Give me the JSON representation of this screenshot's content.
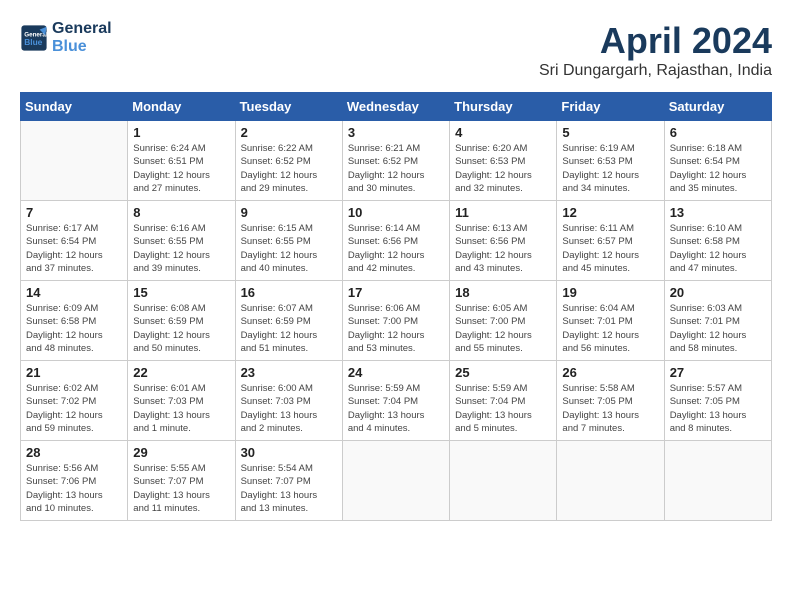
{
  "app": {
    "logo_line1": "General",
    "logo_line2": "Blue",
    "title": "April 2024",
    "subtitle": "Sri Dungargarh, Rajasthan, India"
  },
  "calendar": {
    "headers": [
      "Sunday",
      "Monday",
      "Tuesday",
      "Wednesday",
      "Thursday",
      "Friday",
      "Saturday"
    ],
    "weeks": [
      [
        {
          "day": "",
          "detail": ""
        },
        {
          "day": "1",
          "detail": "Sunrise: 6:24 AM\nSunset: 6:51 PM\nDaylight: 12 hours\nand 27 minutes."
        },
        {
          "day": "2",
          "detail": "Sunrise: 6:22 AM\nSunset: 6:52 PM\nDaylight: 12 hours\nand 29 minutes."
        },
        {
          "day": "3",
          "detail": "Sunrise: 6:21 AM\nSunset: 6:52 PM\nDaylight: 12 hours\nand 30 minutes."
        },
        {
          "day": "4",
          "detail": "Sunrise: 6:20 AM\nSunset: 6:53 PM\nDaylight: 12 hours\nand 32 minutes."
        },
        {
          "day": "5",
          "detail": "Sunrise: 6:19 AM\nSunset: 6:53 PM\nDaylight: 12 hours\nand 34 minutes."
        },
        {
          "day": "6",
          "detail": "Sunrise: 6:18 AM\nSunset: 6:54 PM\nDaylight: 12 hours\nand 35 minutes."
        }
      ],
      [
        {
          "day": "7",
          "detail": "Sunrise: 6:17 AM\nSunset: 6:54 PM\nDaylight: 12 hours\nand 37 minutes."
        },
        {
          "day": "8",
          "detail": "Sunrise: 6:16 AM\nSunset: 6:55 PM\nDaylight: 12 hours\nand 39 minutes."
        },
        {
          "day": "9",
          "detail": "Sunrise: 6:15 AM\nSunset: 6:55 PM\nDaylight: 12 hours\nand 40 minutes."
        },
        {
          "day": "10",
          "detail": "Sunrise: 6:14 AM\nSunset: 6:56 PM\nDaylight: 12 hours\nand 42 minutes."
        },
        {
          "day": "11",
          "detail": "Sunrise: 6:13 AM\nSunset: 6:56 PM\nDaylight: 12 hours\nand 43 minutes."
        },
        {
          "day": "12",
          "detail": "Sunrise: 6:11 AM\nSunset: 6:57 PM\nDaylight: 12 hours\nand 45 minutes."
        },
        {
          "day": "13",
          "detail": "Sunrise: 6:10 AM\nSunset: 6:58 PM\nDaylight: 12 hours\nand 47 minutes."
        }
      ],
      [
        {
          "day": "14",
          "detail": "Sunrise: 6:09 AM\nSunset: 6:58 PM\nDaylight: 12 hours\nand 48 minutes."
        },
        {
          "day": "15",
          "detail": "Sunrise: 6:08 AM\nSunset: 6:59 PM\nDaylight: 12 hours\nand 50 minutes."
        },
        {
          "day": "16",
          "detail": "Sunrise: 6:07 AM\nSunset: 6:59 PM\nDaylight: 12 hours\nand 51 minutes."
        },
        {
          "day": "17",
          "detail": "Sunrise: 6:06 AM\nSunset: 7:00 PM\nDaylight: 12 hours\nand 53 minutes."
        },
        {
          "day": "18",
          "detail": "Sunrise: 6:05 AM\nSunset: 7:00 PM\nDaylight: 12 hours\nand 55 minutes."
        },
        {
          "day": "19",
          "detail": "Sunrise: 6:04 AM\nSunset: 7:01 PM\nDaylight: 12 hours\nand 56 minutes."
        },
        {
          "day": "20",
          "detail": "Sunrise: 6:03 AM\nSunset: 7:01 PM\nDaylight: 12 hours\nand 58 minutes."
        }
      ],
      [
        {
          "day": "21",
          "detail": "Sunrise: 6:02 AM\nSunset: 7:02 PM\nDaylight: 12 hours\nand 59 minutes."
        },
        {
          "day": "22",
          "detail": "Sunrise: 6:01 AM\nSunset: 7:03 PM\nDaylight: 13 hours\nand 1 minute."
        },
        {
          "day": "23",
          "detail": "Sunrise: 6:00 AM\nSunset: 7:03 PM\nDaylight: 13 hours\nand 2 minutes."
        },
        {
          "day": "24",
          "detail": "Sunrise: 5:59 AM\nSunset: 7:04 PM\nDaylight: 13 hours\nand 4 minutes."
        },
        {
          "day": "25",
          "detail": "Sunrise: 5:59 AM\nSunset: 7:04 PM\nDaylight: 13 hours\nand 5 minutes."
        },
        {
          "day": "26",
          "detail": "Sunrise: 5:58 AM\nSunset: 7:05 PM\nDaylight: 13 hours\nand 7 minutes."
        },
        {
          "day": "27",
          "detail": "Sunrise: 5:57 AM\nSunset: 7:05 PM\nDaylight: 13 hours\nand 8 minutes."
        }
      ],
      [
        {
          "day": "28",
          "detail": "Sunrise: 5:56 AM\nSunset: 7:06 PM\nDaylight: 13 hours\nand 10 minutes."
        },
        {
          "day": "29",
          "detail": "Sunrise: 5:55 AM\nSunset: 7:07 PM\nDaylight: 13 hours\nand 11 minutes."
        },
        {
          "day": "30",
          "detail": "Sunrise: 5:54 AM\nSunset: 7:07 PM\nDaylight: 13 hours\nand 13 minutes."
        },
        {
          "day": "",
          "detail": ""
        },
        {
          "day": "",
          "detail": ""
        },
        {
          "day": "",
          "detail": ""
        },
        {
          "day": "",
          "detail": ""
        }
      ]
    ]
  }
}
